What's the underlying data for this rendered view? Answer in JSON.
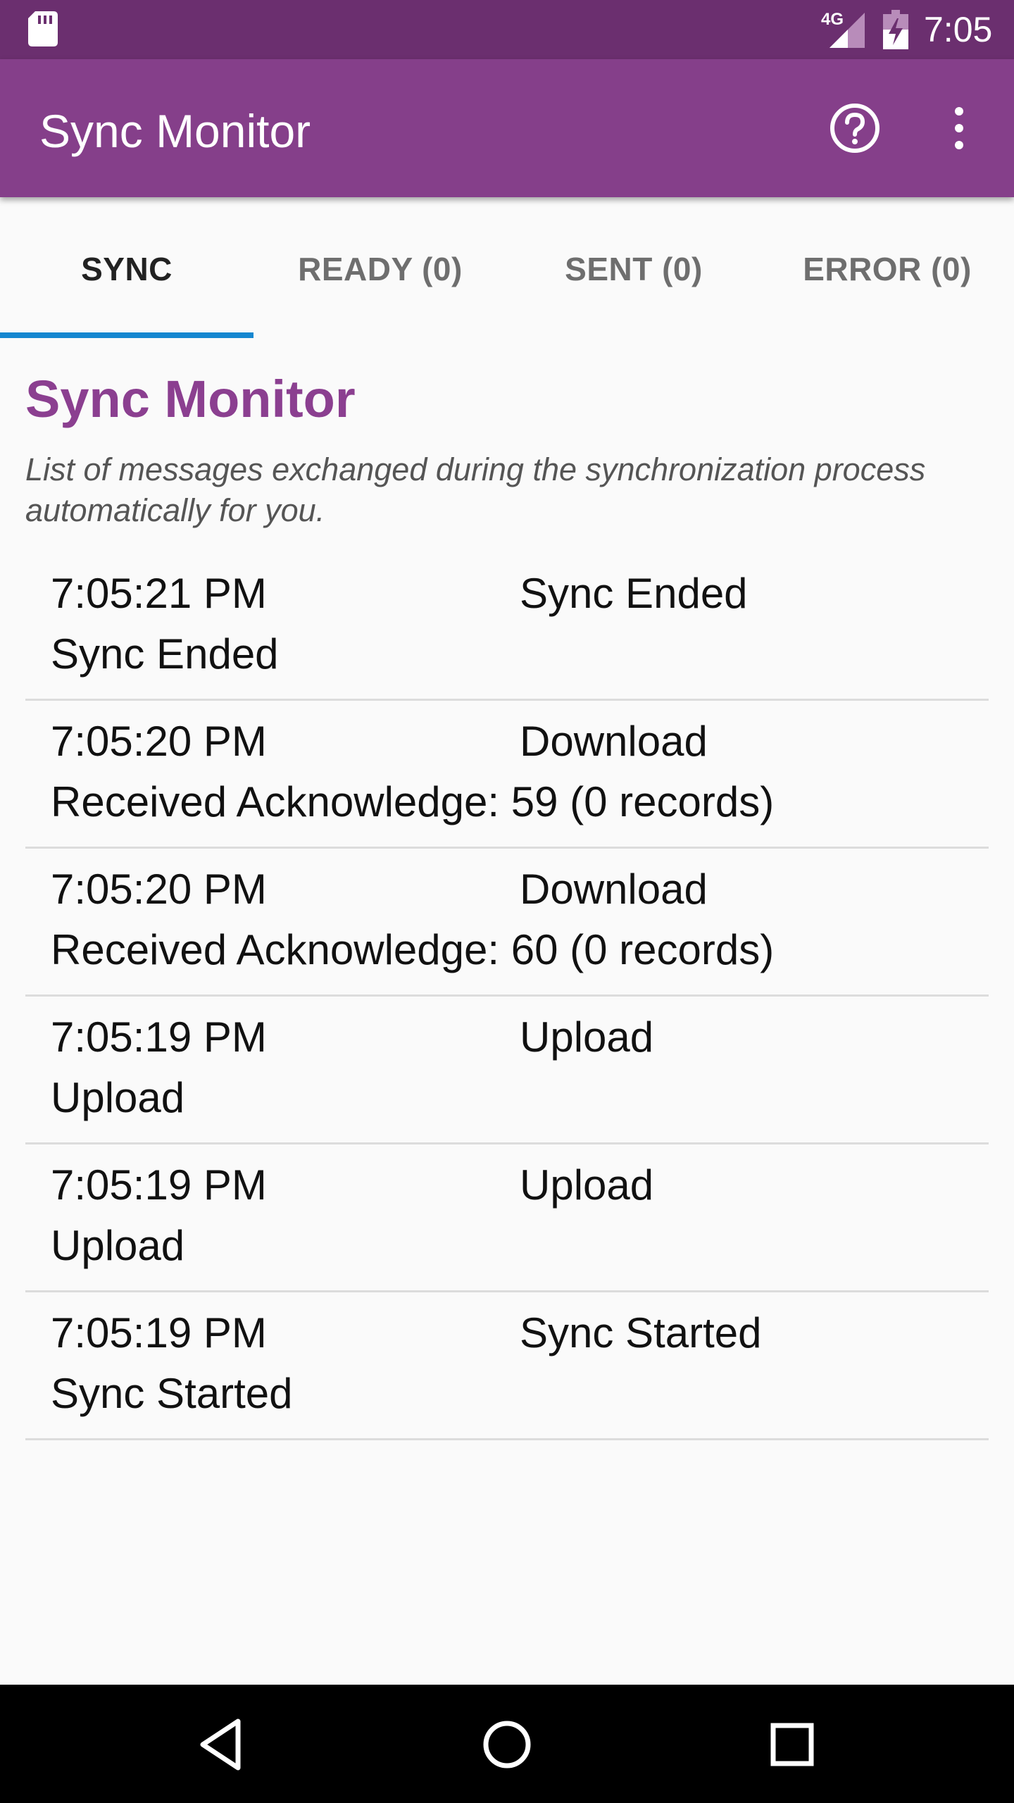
{
  "status_bar": {
    "network": "4G",
    "time": "7:05"
  },
  "app_bar": {
    "title": "Sync Monitor",
    "icons": [
      "help-icon",
      "more-vert-icon"
    ]
  },
  "tabs": [
    {
      "label": "SYNC",
      "active": true
    },
    {
      "label": "READY (0)",
      "active": false
    },
    {
      "label": "SENT (0)",
      "active": false
    },
    {
      "label": "ERROR (0)",
      "active": false
    }
  ],
  "page": {
    "heading": "Sync Monitor",
    "description": "List of messages exchanged during the synchronization process automatically for you."
  },
  "messages": [
    {
      "time": "7:05:21 PM",
      "type": "Sync Ended",
      "detail": "Sync Ended"
    },
    {
      "time": "7:05:20 PM",
      "type": "Download",
      "detail": "Received Acknowledge: 59 (0 records)"
    },
    {
      "time": "7:05:20 PM",
      "type": "Download",
      "detail": "Received Acknowledge: 60 (0 records)"
    },
    {
      "time": "7:05:19 PM",
      "type": "Upload",
      "detail": "Upload"
    },
    {
      "time": "7:05:19 PM",
      "type": "Upload",
      "detail": "Upload"
    },
    {
      "time": "7:05:19 PM",
      "type": "Sync Started",
      "detail": "Sync Started"
    }
  ],
  "colors": {
    "status_bar": "#6b2f6f",
    "app_bar": "#853f8a",
    "heading": "#8b3f90",
    "tab_indicator": "#1687d0"
  }
}
